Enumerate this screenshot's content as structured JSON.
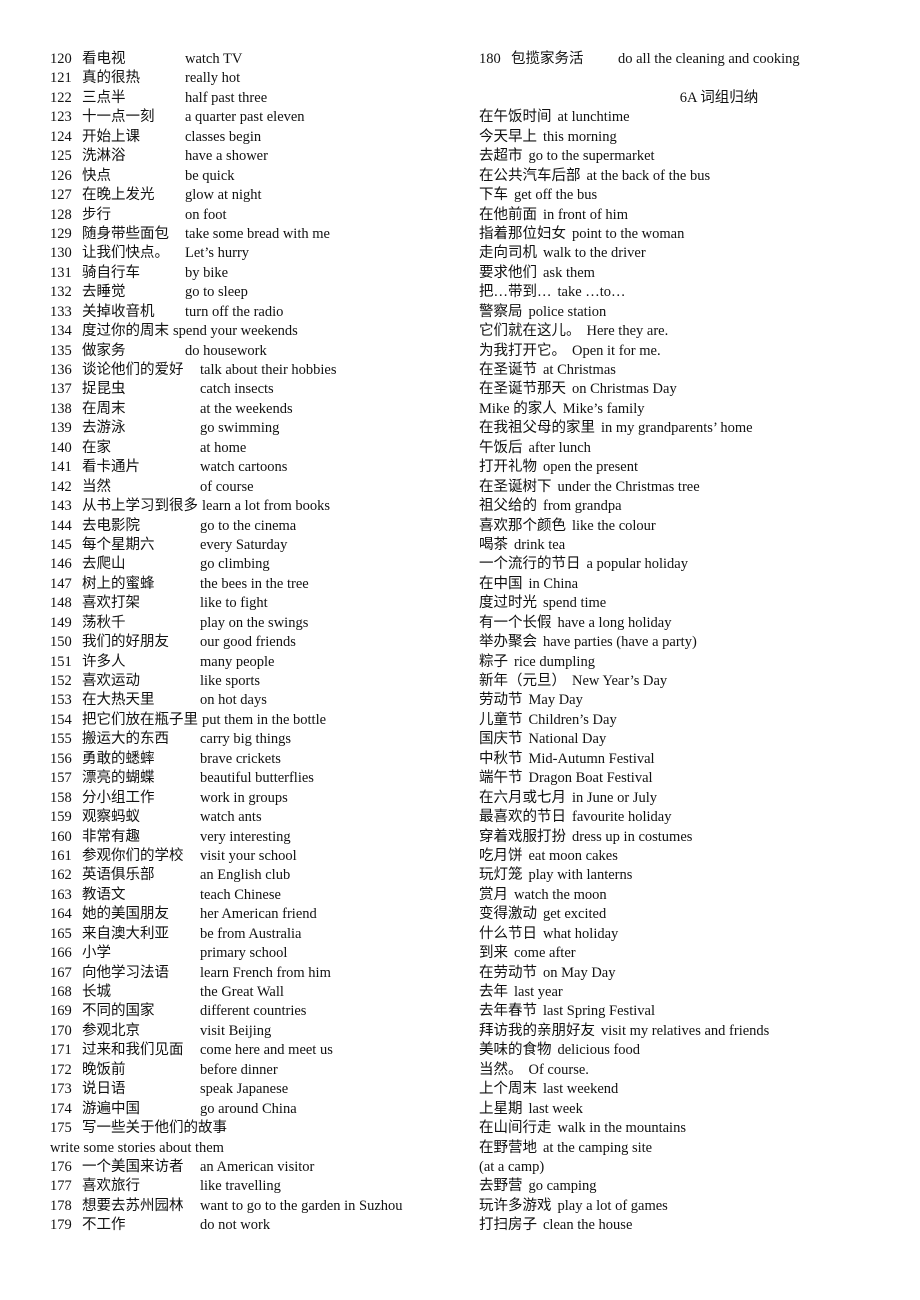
{
  "left_column": {
    "entries": [
      {
        "num": "120",
        "zh": "看电视",
        "en": "watch TV",
        "indent": "a"
      },
      {
        "num": "121",
        "zh": "真的很热",
        "en": "really hot",
        "indent": "a"
      },
      {
        "num": "122",
        "zh": "三点半",
        "en": "half past three",
        "indent": "a"
      },
      {
        "num": "123",
        "zh": "十一点一刻",
        "en": "a quarter past eleven",
        "indent": "a"
      },
      {
        "num": "124",
        "zh": "开始上课",
        "en": "classes begin",
        "indent": "a"
      },
      {
        "num": "125",
        "zh": "洗淋浴",
        "en": "have a shower",
        "indent": "a"
      },
      {
        "num": "126",
        "zh": "快点",
        "en": "be quick",
        "indent": "a"
      },
      {
        "num": "127",
        "zh": "在晚上发光",
        "en": "glow at night",
        "indent": "a"
      },
      {
        "num": "128",
        "zh": "步行",
        "en": "on foot",
        "indent": "a"
      },
      {
        "num": "129",
        "zh": "随身带些面包",
        "en": "take some bread with me",
        "indent": "a"
      },
      {
        "num": "130",
        "zh": "让我们快点。",
        "en": "Let’s hurry",
        "indent": "a"
      },
      {
        "num": "131",
        "zh": "骑自行车",
        "en": "by bike",
        "indent": "a"
      },
      {
        "num": "132",
        "zh": "去睡觉",
        "en": "go to sleep",
        "indent": "a"
      },
      {
        "num": "133",
        "zh": "关掉收音机",
        "en": "turn off the radio",
        "indent": "a"
      },
      {
        "num": "134",
        "zh": "度过你的周末",
        "en": "spend your weekends",
        "indent": "inline"
      },
      {
        "num": "135",
        "zh": "做家务",
        "en": "do housework",
        "indent": "a"
      },
      {
        "num": "136",
        "zh": "谈论他们的爱好",
        "en": "talk about their hobbies",
        "indent": "b"
      },
      {
        "num": "137",
        "zh": "捉昆虫",
        "en": "catch insects",
        "indent": "b"
      },
      {
        "num": "138",
        "zh": "在周末",
        "en": "at the weekends",
        "indent": "b"
      },
      {
        "num": "139",
        "zh": "去游泳",
        "en": "go swimming",
        "indent": "b"
      },
      {
        "num": "140",
        "zh": "在家",
        "en": "at home",
        "indent": "b"
      },
      {
        "num": "141",
        "zh": "看卡通片",
        "en": "watch cartoons",
        "indent": "b"
      },
      {
        "num": "142",
        "zh": "当然",
        "en": "of    course",
        "indent": "b"
      },
      {
        "num": "143",
        "zh": "从书上学习到很多",
        "en": "learn a lot from books",
        "indent": "inline"
      },
      {
        "num": "144",
        "zh": "去电影院",
        "en": "go to the cinema",
        "indent": "b"
      },
      {
        "num": "145",
        "zh": "每个星期六",
        "en": "every Saturday",
        "indent": "b"
      },
      {
        "num": "146",
        "zh": "去爬山",
        "en": "go climbing",
        "indent": "b"
      },
      {
        "num": "147",
        "zh": "树上的蜜蜂",
        "en": "the bees in the tree",
        "indent": "b"
      },
      {
        "num": "148",
        "zh": "喜欢打架",
        "en": "like to fight",
        "indent": "b"
      },
      {
        "num": "149",
        "zh": "荡秋千",
        "en": "play on the swings",
        "indent": "b"
      },
      {
        "num": "150",
        "zh": "我们的好朋友",
        "en": "our good friends",
        "indent": "b"
      },
      {
        "num": "151",
        "zh": "许多人",
        "en": "many people",
        "indent": "b"
      },
      {
        "num": "152",
        "zh": "喜欢运动",
        "en": "like sports",
        "indent": "b"
      },
      {
        "num": "153",
        "zh": "在大热天里",
        "en": "on hot days",
        "indent": "b"
      },
      {
        "num": "154",
        "zh": "把它们放在瓶子里",
        "en": "put them in the bottle",
        "indent": "inline"
      },
      {
        "num": "155",
        "zh": "搬运大的东西",
        "en": "carry big things",
        "indent": "b"
      },
      {
        "num": "156",
        "zh": "勇敢的蟋蟀",
        "en": "brave crickets",
        "indent": "b"
      },
      {
        "num": "157",
        "zh": "漂亮的蝴蝶",
        "en": "beautiful butterflies",
        "indent": "b"
      },
      {
        "num": "158",
        "zh": "分小组工作",
        "en": "work in groups",
        "indent": "b"
      },
      {
        "num": "159",
        "zh": "观察蚂蚁",
        "en": "watch ants",
        "indent": "b"
      },
      {
        "num": "160",
        "zh": "非常有趣",
        "en": "very interesting",
        "indent": "b"
      },
      {
        "num": "161",
        "zh": "参观你们的学校",
        "en": "visit your school",
        "indent": "b"
      },
      {
        "num": "162",
        "zh": "英语俱乐部",
        "en": "an English club",
        "indent": "b"
      },
      {
        "num": "163",
        "zh": "教语文",
        "en": "teach Chinese",
        "indent": "b"
      },
      {
        "num": "164",
        "zh": "她的美国朋友",
        "en": "her American friend",
        "indent": "b"
      },
      {
        "num": "165",
        "zh": "来自澳大利亚",
        "en": "be from Australia",
        "indent": "b"
      },
      {
        "num": "166",
        "zh": "小学",
        "en": "primary school",
        "indent": "b"
      },
      {
        "num": "167",
        "zh": "向他学习法语",
        "en": "learn French from him",
        "indent": "b"
      },
      {
        "num": "168",
        "zh": "长城",
        "en": "the Great Wall",
        "indent": "b"
      },
      {
        "num": "169",
        "zh": "不同的国家",
        "en": "different countries",
        "indent": "b"
      },
      {
        "num": "170",
        "zh": "参观北京",
        "en": "visit Beijing",
        "indent": "b"
      },
      {
        "num": "171",
        "zh": "过来和我们见面",
        "en": "come here and meet us",
        "indent": "b"
      },
      {
        "num": "172",
        "zh": "晚饭前",
        "en": "before dinner",
        "indent": "b"
      },
      {
        "num": "173",
        "zh": "说日语",
        "en": "speak Japanese",
        "indent": "b"
      },
      {
        "num": "174",
        "zh": "游遍中国",
        "en": "go around China",
        "indent": "b"
      },
      {
        "num": "175",
        "zh": "写一些关于他们的故事",
        "en": "",
        "indent": "none"
      },
      {
        "num": "",
        "zh": "",
        "en": "write some stories about them",
        "indent": "wrap"
      },
      {
        "num": "176",
        "zh": "一个美国来访者",
        "en": "an American visitor",
        "indent": "b"
      },
      {
        "num": "177",
        "zh": "喜欢旅行",
        "en": "like travelling",
        "indent": "b"
      },
      {
        "num": "178",
        "zh": "想要去苏州园林",
        "en": "want to go to the garden in Suzhou",
        "indent": "b"
      },
      {
        "num": "179",
        "zh": "不工作",
        "en": "do not work",
        "indent": "b"
      }
    ]
  },
  "right_column": {
    "top_entry": {
      "num": "180",
      "zh": "包揽家务活",
      "en": "do all the cleaning and cooking"
    },
    "section_title": "6A 词组归纳",
    "entries": [
      {
        "zh": "在午饭时间",
        "en": "at lunchtime"
      },
      {
        "zh": "今天早上",
        "en": "this morning"
      },
      {
        "zh": "去超市",
        "en": "go to the supermarket"
      },
      {
        "zh": "在公共汽车后部",
        "en": "at the back of the bus"
      },
      {
        "zh": "下车",
        "en": "get off the bus"
      },
      {
        "zh": "在他前面",
        "en": "in front of him"
      },
      {
        "zh": "指着那位妇女",
        "en": "point to the woman"
      },
      {
        "zh": "走向司机",
        "en": "walk to the driver"
      },
      {
        "zh": "要求他们",
        "en": "ask them"
      },
      {
        "zh": "把…带到…",
        "en": "take  …to…"
      },
      {
        "zh": "警察局",
        "en": "police station"
      },
      {
        "zh": "它们就在这儿。",
        "en": "Here they are."
      },
      {
        "zh": "为我打开它。",
        "en": "Open it for me."
      },
      {
        "zh": "在圣诞节",
        "en": "at Christmas"
      },
      {
        "zh": "在圣诞节那天",
        "en": "on Christmas Day"
      },
      {
        "zh": "Mike 的家人",
        "en": "Mike’s family"
      },
      {
        "zh": "在我祖父母的家里",
        "en": "in my grandparents’ home"
      },
      {
        "zh": "午饭后",
        "en": "after lunch"
      },
      {
        "zh": "打开礼物",
        "en": "open the present"
      },
      {
        "zh": "在圣诞树下",
        "en": "under the Christmas tree"
      },
      {
        "zh": "祖父给的",
        "en": "from grandpa"
      },
      {
        "zh": "喜欢那个颜色",
        "en": "like the colour"
      },
      {
        "zh": "喝茶",
        "en": "drink tea"
      },
      {
        "zh": "一个流行的节日",
        "en": "a popular holiday"
      },
      {
        "zh": "在中国",
        "en": "in China"
      },
      {
        "zh": "度过时光",
        "en": "spend time"
      },
      {
        "zh": "有一个长假",
        "en": "have a long holiday"
      },
      {
        "zh": "举办聚会",
        "en": "have parties (have a party)"
      },
      {
        "zh": "粽子",
        "en": "rice dumpling"
      },
      {
        "zh": "新年（元旦）",
        "en": "New Year’s Day"
      },
      {
        "zh": "劳动节",
        "en": "May Day"
      },
      {
        "zh": "儿童节",
        "en": "Children’s Day"
      },
      {
        "zh": "国庆节",
        "en": "National Day"
      },
      {
        "zh": "中秋节",
        "en": "Mid-Autumn Festival"
      },
      {
        "zh": "端午节",
        "en": "Dragon Boat Festival"
      },
      {
        "zh": "在六月或七月",
        "en": "in June or July"
      },
      {
        "zh": "最喜欢的节日",
        "en": "favourite holiday"
      },
      {
        "zh": "穿着戏服打扮",
        "en": "dress up in costumes"
      },
      {
        "zh": "吃月饼",
        "en": "eat moon cakes"
      },
      {
        "zh": "玩灯笼",
        "en": "play with lanterns"
      },
      {
        "zh": "赏月",
        "en": "watch the moon"
      },
      {
        "zh": "变得激动",
        "en": "get excited"
      },
      {
        "zh": "什么节日",
        "en": "what holiday"
      },
      {
        "zh": "到来",
        "en": "come after"
      },
      {
        "zh": "在劳动节",
        "en": "on May Day"
      },
      {
        "zh": "去年",
        "en": "last year"
      },
      {
        "zh": "去年春节",
        "en": "last Spring Festival"
      },
      {
        "zh": "拜访我的亲朋好友",
        "en": "visit my relatives and friends"
      },
      {
        "zh": "美味的食物",
        "en": "delicious food"
      },
      {
        "zh": "当然。",
        "en": "Of course."
      },
      {
        "zh": "上个周末",
        "en": "last weekend"
      },
      {
        "zh": "上星期",
        "en": "last week"
      },
      {
        "zh": "在山间行走",
        "en": "walk in the mountains"
      },
      {
        "zh": "在野营地",
        "en": "at the camping site"
      },
      {
        "zh": "",
        "en": "(at a camp)"
      },
      {
        "zh": "去野营",
        "en": "go camping"
      },
      {
        "zh": "玩许多游戏",
        "en": "play a lot of games"
      },
      {
        "zh": "打扫房子",
        "en": "clean the house"
      }
    ]
  }
}
